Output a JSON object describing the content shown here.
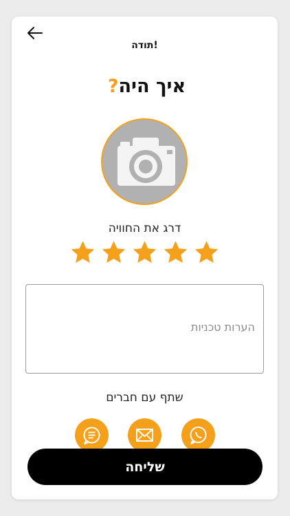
{
  "header": {
    "title": "תודה!",
    "back_icon": "arrow-left-icon"
  },
  "main": {
    "question": "איך היה",
    "question_mark": "?",
    "photo_icon": "camera-icon",
    "rating_label": "דרג את החוויה",
    "rating": {
      "value": 5,
      "max": 5
    },
    "comments_placeholder": "הערות טכניות",
    "comments_value": "",
    "share_label": "שתף עם חברים",
    "share_icons": [
      "message-icon",
      "mail-icon",
      "whatsapp-icon"
    ]
  },
  "submit_label": "שליחה",
  "colors": {
    "accent": "#f5a01a",
    "button": "#000000"
  }
}
